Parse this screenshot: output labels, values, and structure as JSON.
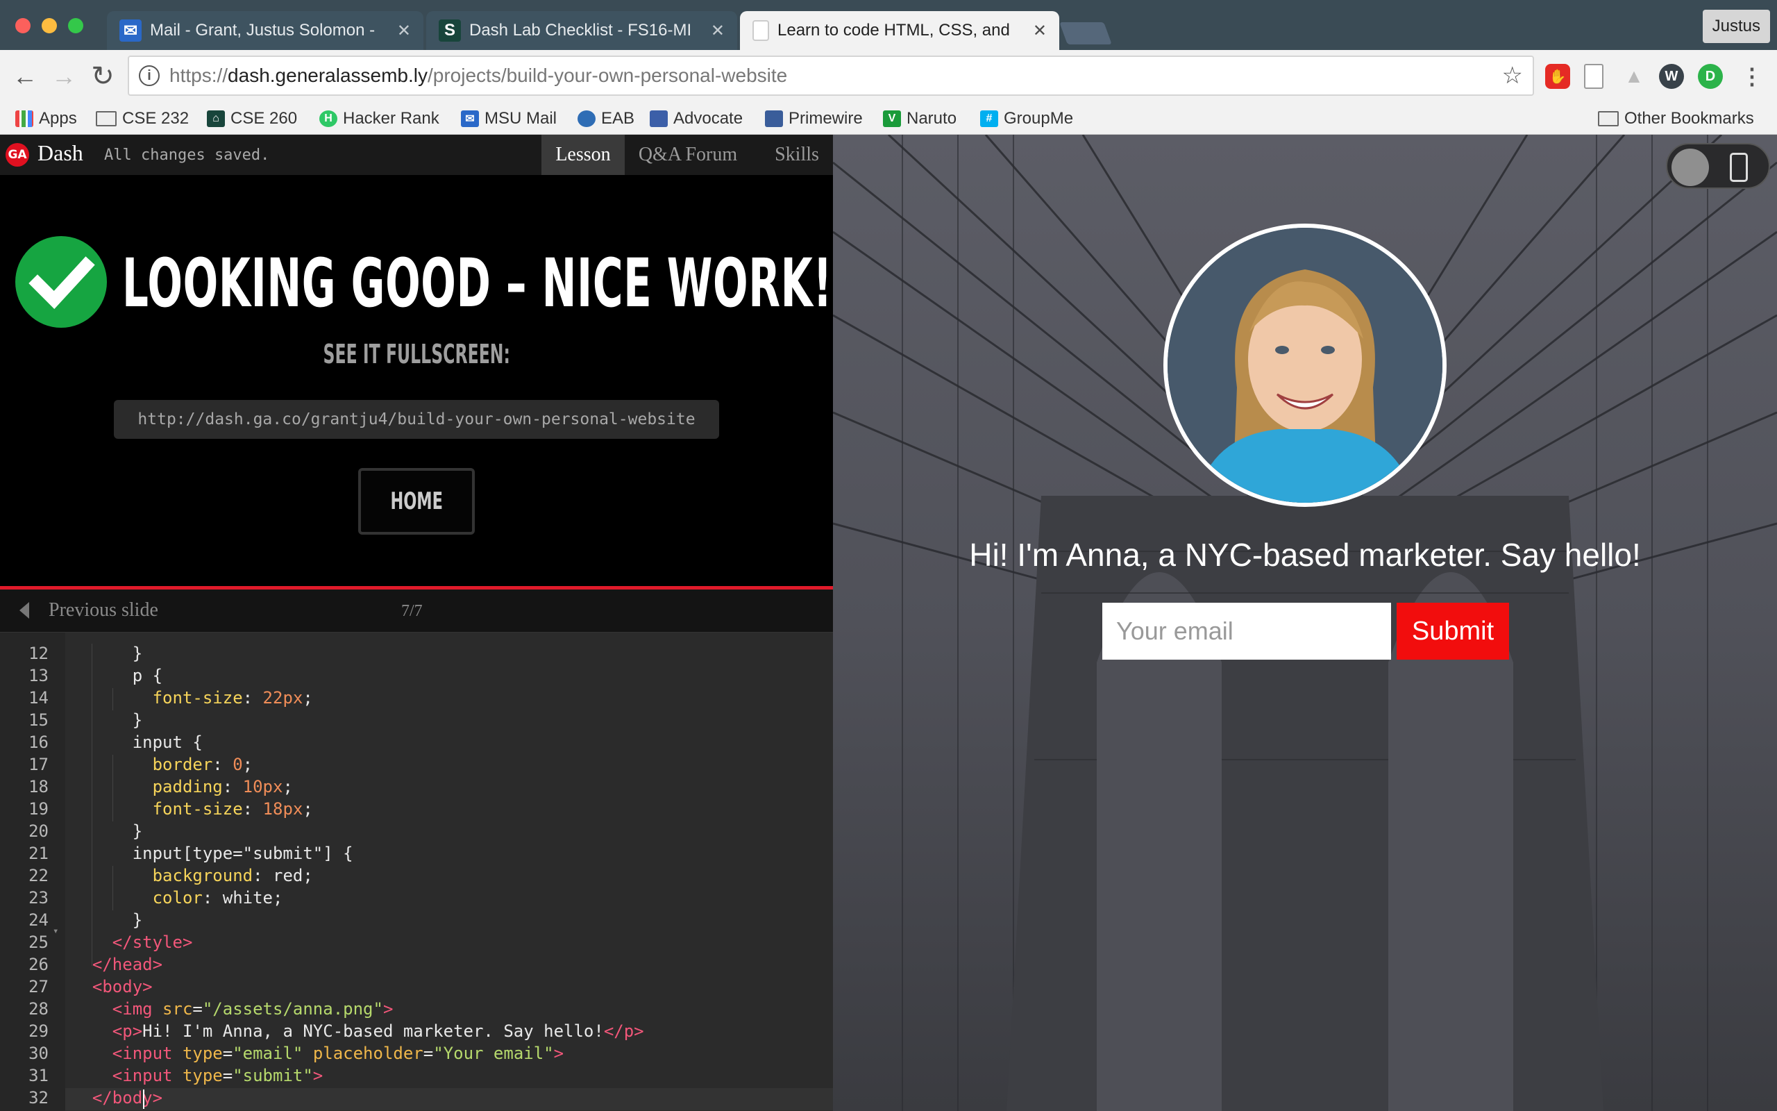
{
  "browser": {
    "tabs": [
      {
        "title": "Mail - Grant, Justus Solomon -",
        "favicon": "mail-icon",
        "color": "#2a68c8"
      },
      {
        "title": "Dash Lab Checklist - FS16-MI",
        "favicon": "spartan-s-icon",
        "color": "#18453b"
      },
      {
        "title": "Learn to code HTML, CSS, and",
        "favicon": "page-icon",
        "color": "#dddddd"
      }
    ],
    "profile_name": "Justus",
    "url": {
      "scheme": "https://",
      "host": "dash.generalassemb.ly",
      "path": "/projects/build-your-own-personal-website"
    },
    "bookmarks": [
      {
        "label": "Apps",
        "icon": "apps-grid-icon"
      },
      {
        "label": "CSE 232",
        "icon": "folder-icon"
      },
      {
        "label": "CSE 260",
        "icon": "spartan-icon"
      },
      {
        "label": "Hacker Rank",
        "icon": "hackerrank-icon"
      },
      {
        "label": "MSU Mail",
        "icon": "mail-icon"
      },
      {
        "label": "EAB",
        "icon": "eab-icon"
      },
      {
        "label": "Advocate",
        "icon": "advocate-icon"
      },
      {
        "label": "Primewire",
        "icon": "primewire-icon"
      },
      {
        "label": "Naruto",
        "icon": "naruto-icon"
      },
      {
        "label": "GroupMe",
        "icon": "groupme-icon"
      }
    ],
    "other_bookmarks": "Other Bookmarks"
  },
  "dash": {
    "logo_text": "GA",
    "title": "Dash",
    "save_status": "All changes saved.",
    "tabs": [
      "Lesson",
      "Q&A Forum",
      "Skills"
    ],
    "active_tab": "Lesson",
    "headline": "LOOKING GOOD – NICE WORK!",
    "see_fullscreen": "SEE IT FULLSCREEN:",
    "fullscreen_url": "http://dash.ga.co/grantju4/build-your-own-personal-website",
    "home_label": "HOME",
    "prev_slide": "Previous slide",
    "slide_counter": "7/7",
    "accent": "#e01a2a",
    "success": "#16a541"
  },
  "editor": {
    "line_numbers": [
      "12",
      "13",
      "14",
      "15",
      "16",
      "17",
      "18",
      "19",
      "20",
      "21",
      "22",
      "23",
      "24",
      "25",
      "26",
      "27",
      "28",
      "29",
      "30",
      "31",
      "32"
    ]
  },
  "preview": {
    "greeting": "Hi! I'm Anna, a NYC-based marketer. Say hello!",
    "email_placeholder": "Your email",
    "submit_label": "Submit",
    "submit_color": "#f20d0d"
  }
}
